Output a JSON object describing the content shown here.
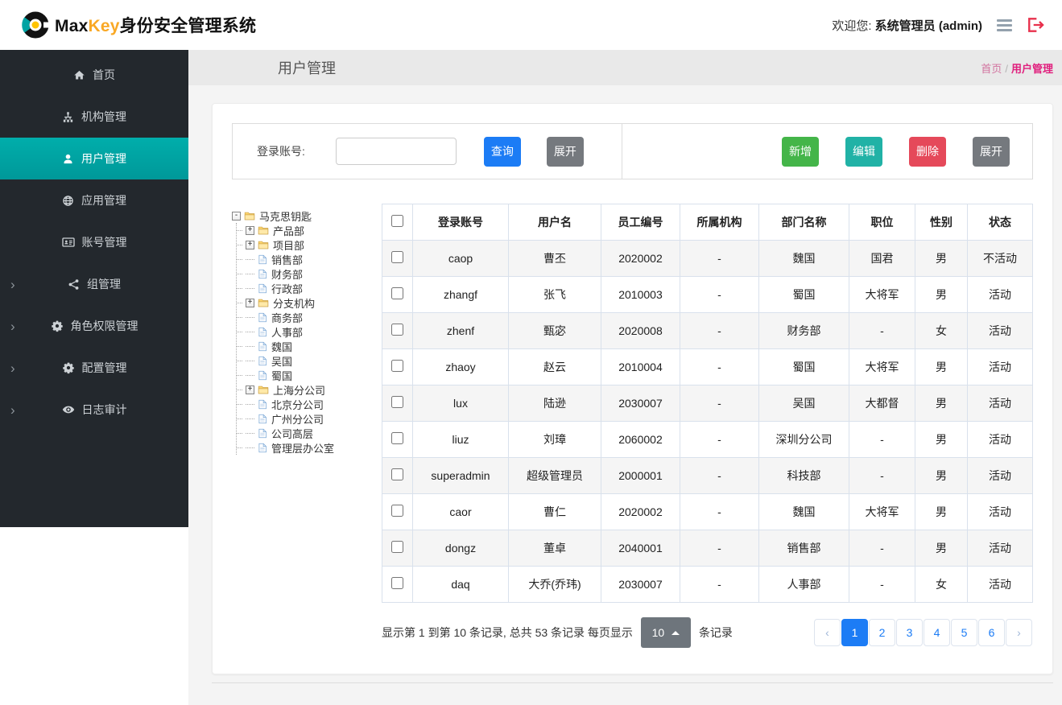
{
  "colors": {
    "brand_orange": "#f9a825",
    "sidebar_bg": "#23282d",
    "accent_teal": "#00a2a0",
    "query_blue": "#1c7cf5",
    "gray_btn": "#75797e",
    "add_green": "#44b549",
    "edit_teal": "#21b2a6",
    "delete_red": "#e5495a",
    "breadcrumb_pink": "#e01f7d",
    "pagination_blue": "#1c7cf5",
    "pagesize_gray": "#6e757c"
  },
  "header": {
    "brand_max": "Max",
    "brand_key": "Key",
    "brand_suffix": "身份安全管理系统",
    "welcome_prefix": "欢迎您:",
    "welcome_user": "系统管理员 (admin)"
  },
  "sidebar": {
    "items": [
      {
        "id": "home",
        "label": "首页",
        "icon": "home"
      },
      {
        "id": "org",
        "label": "机构管理",
        "icon": "sitemap"
      },
      {
        "id": "user",
        "label": "用户管理",
        "icon": "user",
        "active": true
      },
      {
        "id": "app",
        "label": "应用管理",
        "icon": "globe"
      },
      {
        "id": "account",
        "label": "账号管理",
        "icon": "idcard"
      },
      {
        "id": "group",
        "label": "组管理",
        "icon": "share",
        "expandable": true
      },
      {
        "id": "role",
        "label": "角色权限管理",
        "icon": "gears",
        "expandable": true
      },
      {
        "id": "config",
        "label": "配置管理",
        "icon": "gears",
        "expandable": true
      },
      {
        "id": "audit",
        "label": "日志审计",
        "icon": "eye",
        "expandable": true
      }
    ]
  },
  "page": {
    "title": "用户管理",
    "breadcrumb_home": "首页",
    "breadcrumb_sep": "/",
    "breadcrumb_current": "用户管理"
  },
  "toolbar": {
    "search_label": "登录账号:",
    "search_value": "",
    "query": "查询",
    "expand": "展开",
    "add": "新增",
    "edit": "编辑",
    "delete": "删除",
    "expand2": "展开"
  },
  "tree": {
    "root": "马克思钥匙",
    "nodes": [
      {
        "label": "产品部",
        "type": "folder",
        "expandable": true
      },
      {
        "label": "项目部",
        "type": "folder",
        "expandable": true
      },
      {
        "label": "销售部",
        "type": "file"
      },
      {
        "label": "财务部",
        "type": "file"
      },
      {
        "label": "行政部",
        "type": "file"
      },
      {
        "label": "分支机构",
        "type": "folder",
        "expandable": true
      },
      {
        "label": "商务部",
        "type": "file"
      },
      {
        "label": "人事部",
        "type": "file"
      },
      {
        "label": "魏国",
        "type": "file"
      },
      {
        "label": "吴国",
        "type": "file"
      },
      {
        "label": "蜀国",
        "type": "file"
      },
      {
        "label": "上海分公司",
        "type": "folder",
        "expandable": true
      },
      {
        "label": "北京分公司",
        "type": "file"
      },
      {
        "label": "广州分公司",
        "type": "file"
      },
      {
        "label": "公司高层",
        "type": "file"
      },
      {
        "label": "管理层办公室",
        "type": "file"
      }
    ]
  },
  "table": {
    "columns": [
      "登录账号",
      "用户名",
      "员工编号",
      "所属机构",
      "部门名称",
      "职位",
      "性别",
      "状态"
    ],
    "rows": [
      [
        "caop",
        "曹丕",
        "2020002",
        "-",
        "魏国",
        "国君",
        "男",
        "不活动"
      ],
      [
        "zhangf",
        "张飞",
        "2010003",
        "-",
        "蜀国",
        "大将军",
        "男",
        "活动"
      ],
      [
        "zhenf",
        "甄宓",
        "2020008",
        "-",
        "财务部",
        "-",
        "女",
        "活动"
      ],
      [
        "zhaoy",
        "赵云",
        "2010004",
        "-",
        "蜀国",
        "大将军",
        "男",
        "活动"
      ],
      [
        "lux",
        "陆逊",
        "2030007",
        "-",
        "吴国",
        "大都督",
        "男",
        "活动"
      ],
      [
        "liuz",
        "刘璋",
        "2060002",
        "-",
        "深圳分公司",
        "-",
        "男",
        "活动"
      ],
      [
        "superadmin",
        "超级管理员",
        "2000001",
        "-",
        "科技部",
        "-",
        "男",
        "活动"
      ],
      [
        "caor",
        "曹仁",
        "2020002",
        "-",
        "魏国",
        "大将军",
        "男",
        "活动"
      ],
      [
        "dongz",
        "董卓",
        "2040001",
        "-",
        "销售部",
        "-",
        "男",
        "活动"
      ],
      [
        "daq",
        "大乔(乔玮)",
        "2030007",
        "-",
        "人事部",
        "-",
        "女",
        "活动"
      ]
    ]
  },
  "pagination": {
    "summary_before": "显示第 1 到第 10 条记录, 总共 53 条记录 每页显示",
    "page_size": "10",
    "summary_after": "条记录",
    "prev": "‹",
    "next": "›",
    "pages": [
      "1",
      "2",
      "3",
      "4",
      "5",
      "6"
    ],
    "active_page": "1"
  }
}
